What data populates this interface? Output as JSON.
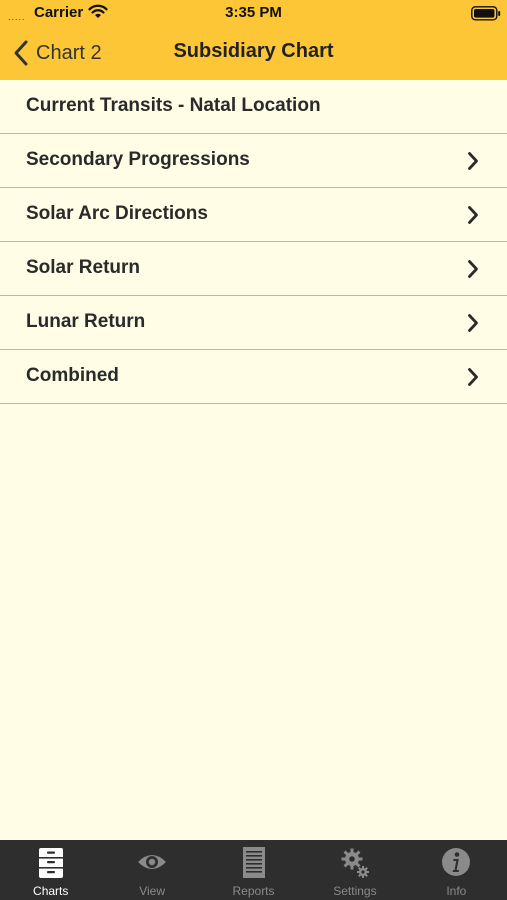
{
  "status_bar": {
    "carrier": "Carrier",
    "time": "3:35 PM",
    "signal": "....."
  },
  "navbar": {
    "back_label": "Chart 2",
    "title": "Subsidiary Chart",
    "background": "#fdc637"
  },
  "list": {
    "items": [
      {
        "label": "Current Transits - Natal Location",
        "chevron": false
      },
      {
        "label": "Secondary Progressions",
        "chevron": true
      },
      {
        "label": "Solar Arc Directions",
        "chevron": true
      },
      {
        "label": "Solar Return",
        "chevron": true
      },
      {
        "label": "Lunar Return",
        "chevron": true
      },
      {
        "label": "Combined",
        "chevron": true
      }
    ],
    "background": "#fffde6"
  },
  "tabbar": {
    "tabs": [
      {
        "label": "Charts",
        "icon": "cabinet-icon",
        "active": true
      },
      {
        "label": "View",
        "icon": "eye-icon",
        "active": false
      },
      {
        "label": "Reports",
        "icon": "document-icon",
        "active": false
      },
      {
        "label": "Settings",
        "icon": "gears-icon",
        "active": false
      },
      {
        "label": "Info",
        "icon": "info-icon",
        "active": false
      }
    ],
    "background": "#2e2e2e"
  }
}
